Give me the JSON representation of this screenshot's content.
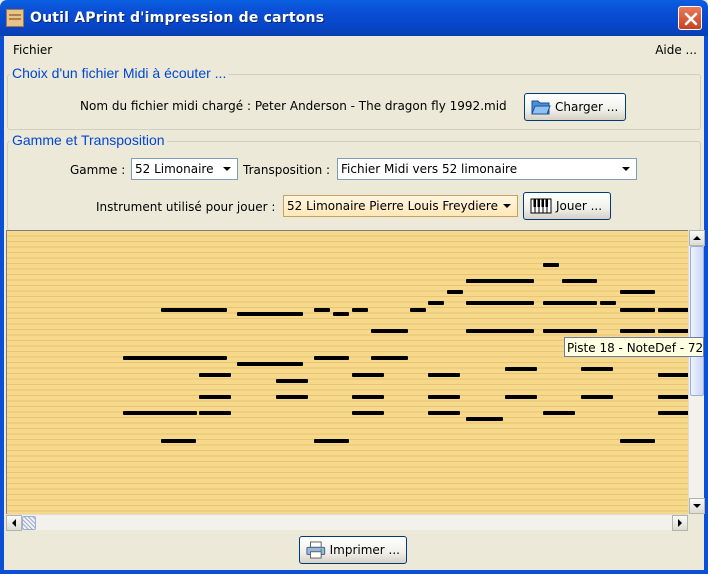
{
  "window": {
    "title": "Outil APrint d'impression de cartons"
  },
  "menu": {
    "file": "Fichier",
    "help": "Aide ..."
  },
  "midi_section": {
    "title": "Choix d'un fichier Midi à écouter ...",
    "file_label": "Nom du fichier midi chargé : Peter Anderson - The dragon fly  1992.mid",
    "load_button": "Charger ..."
  },
  "transpose_section": {
    "title": "Gamme et Transposition",
    "scale_label": "Gamme :",
    "scale_value": "52 Limonaire",
    "transposition_label": "Transposition :",
    "transposition_value": "Fichier Midi vers 52 limonaire",
    "instrument_label": "Instrument utilisé pour jouer :",
    "instrument_value": "52 Limonaire Pierre Louis Freydiere",
    "play_button": "Jouer ..."
  },
  "tooltip": "Piste 18 - NoteDef - 72",
  "footer": {
    "print_button": "Imprimer ..."
  },
  "colors": {
    "title_bar": "#0a4fd6",
    "group_title": "#0046d5",
    "roll_background": "#f7d98c",
    "note": "#000000"
  },
  "icons": {
    "app": "app-icon",
    "close": "close-icon",
    "folder": "folder-open-icon",
    "piano": "piano-keyboard-icon",
    "printer": "printer-icon"
  }
}
